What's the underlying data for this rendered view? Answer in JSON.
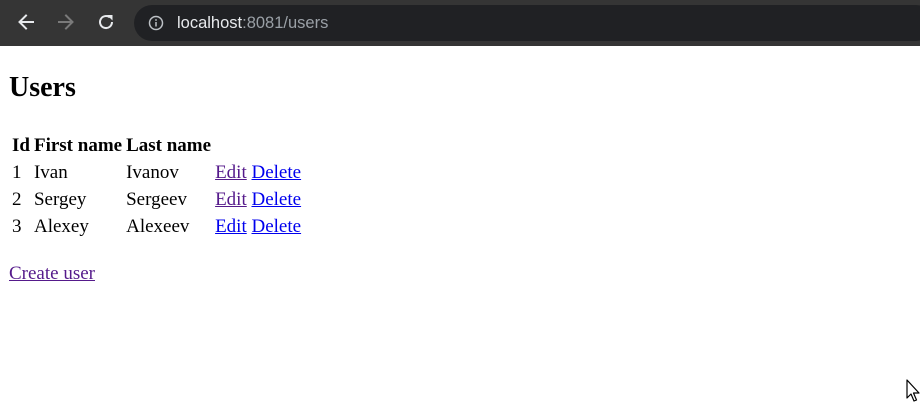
{
  "browser": {
    "url_host": "localhost",
    "url_rest": ":8081/users",
    "icons": {
      "back": "arrow-left-icon",
      "forward": "arrow-right-icon",
      "reload": "reload-icon",
      "site_info": "info-icon"
    }
  },
  "page": {
    "title": "Users",
    "table": {
      "headers": [
        "Id",
        "First name",
        "Last name"
      ],
      "rows": [
        {
          "id": "1",
          "first": "Ivan",
          "last": "Ivanov",
          "edit": "Edit",
          "delete": "Delete"
        },
        {
          "id": "2",
          "first": "Sergey",
          "last": "Sergeev",
          "edit": "Edit",
          "delete": "Delete"
        },
        {
          "id": "3",
          "first": "Alexey",
          "last": "Alexeev",
          "edit": "Edit",
          "delete": "Delete"
        }
      ]
    },
    "create_link": "Create user"
  },
  "colors": {
    "link": "#0000ee",
    "visited_link": "#551a8b",
    "toolbar": "#353535",
    "omnibox": "#202124"
  }
}
